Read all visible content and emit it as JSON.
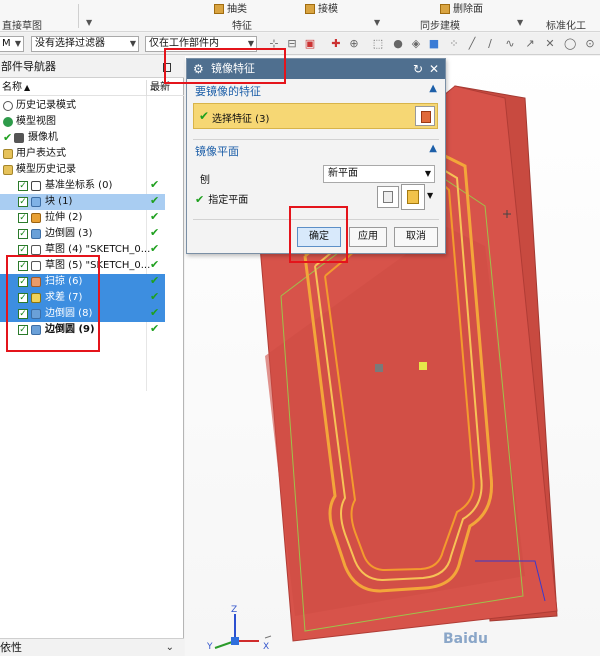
{
  "ribbon": {
    "groups": [
      "直接草图",
      "特征",
      "同步建模",
      "标准化工"
    ],
    "buttons": [
      "抽类",
      "接模",
      "删除面"
    ]
  },
  "filterbar": {
    "mode_value": "M",
    "filter_value": "没有选择过滤器",
    "scope_value": "仅在工作部件内"
  },
  "navigator": {
    "title": "部件导航器",
    "col_name": "名称",
    "col_latest": "最新",
    "items": [
      {
        "label": "历史记录模式",
        "latest": ""
      },
      {
        "label": "模型视图",
        "latest": ""
      },
      {
        "label": "摄像机",
        "latest": ""
      },
      {
        "label": "用户表达式",
        "latest": ""
      },
      {
        "label": "模型历史记录",
        "latest": ""
      },
      {
        "label": "基准坐标系 (0)",
        "latest": "✔"
      },
      {
        "label": "块 (1)",
        "latest": "✔"
      },
      {
        "label": "拉伸 (2)",
        "latest": "✔"
      },
      {
        "label": "边倒圆 (3)",
        "latest": "✔"
      },
      {
        "label": "草图 (4) \"SKETCH_0...",
        "latest": "✔"
      },
      {
        "label": "草图 (5) \"SKETCH_0...",
        "latest": "✔"
      },
      {
        "label": "扫掠 (6)",
        "latest": "✔"
      },
      {
        "label": "求差 (7)",
        "latest": "✔"
      },
      {
        "label": "边倒圆 (8)",
        "latest": "✔"
      },
      {
        "label": "边倒圆 (9)",
        "latest": "✔"
      }
    ],
    "footer": "依性"
  },
  "dialog": {
    "title": "镜像特征",
    "section_feature": "要镜像的特征",
    "select_feature": "选择特征 (3)",
    "section_plane": "镜像平面",
    "plane_label": "刨",
    "plane_value": "新平面",
    "specify_plane": "指定平面",
    "ok": "确定",
    "apply": "应用",
    "cancel": "取消"
  },
  "triad": {
    "x": "X",
    "y": "Y",
    "z": "Z"
  },
  "watermark": "Baidu"
}
